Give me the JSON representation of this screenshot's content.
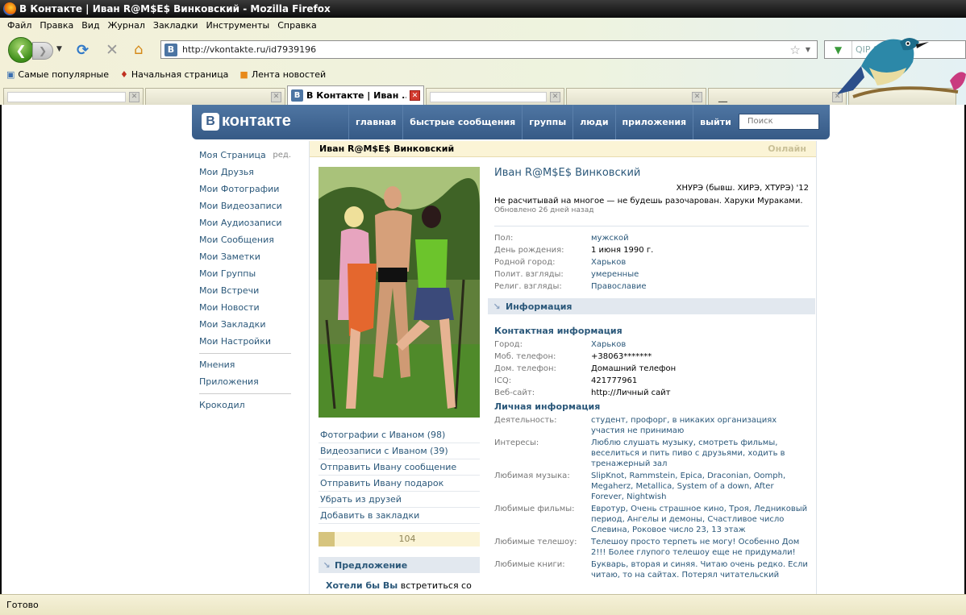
{
  "window": {
    "title": "В Контакте | Иван R@M$E$ Винковский - Mozilla Firefox"
  },
  "menu": [
    "Файл",
    "Правка",
    "Вид",
    "Журнал",
    "Закладки",
    "Инструменты",
    "Справка"
  ],
  "address_bar": {
    "url": "http://vkontakte.ru/id7939196"
  },
  "search_bar": {
    "placeholder": "QIP Search"
  },
  "bookmarks": [
    "Самые популярные",
    "Начальная страница",
    "Лента новостей"
  ],
  "tabs": {
    "active_label": "В Контакте | Иван ...",
    "last_label": "__"
  },
  "vk": {
    "logo": "контакте",
    "logo_letter": "В",
    "nav": [
      "главная",
      "быстрые сообщения",
      "группы",
      "люди",
      "приложения",
      "выйти"
    ],
    "search_placeholder": "Поиск"
  },
  "left_menu": {
    "primary": [
      "Моя Страница",
      "Мои Друзья",
      "Мои Фотографии",
      "Мои Видеозаписи",
      "Мои Аудиозаписи",
      "Мои Сообщения",
      "Мои Заметки",
      "Мои Группы",
      "Мои Встречи",
      "Мои Новости",
      "Мои Закладки",
      "Мои Настройки"
    ],
    "edit_label": "ред.",
    "secondary": [
      "Мнения",
      "Приложения"
    ],
    "tertiary": [
      "Крокодил"
    ]
  },
  "profile": {
    "header_name": "Иван R@M$E$ Винковский",
    "online": "Онлайн",
    "name": "Иван R@M$E$ Винковский",
    "education": "ХНУРЭ (бывш. ХИРЭ, ХТУРЭ) '12",
    "status": "Не расчитывай на многое — не будешь разочарован. Харуки Мураками.",
    "updated": "Обновлено 26 дней назад",
    "basic": [
      {
        "k": "Пол:",
        "v": "мужской"
      },
      {
        "k": "День рождения:",
        "v": "1 июня 1990 г."
      },
      {
        "k": "Родной город:",
        "v": "Харьков"
      },
      {
        "k": "Полит. взгляды:",
        "v": "умеренные"
      },
      {
        "k": "Религ. взгляды:",
        "v": "Православие"
      }
    ],
    "info_title": "Информация",
    "contact_title": "Контактная информация",
    "contact": [
      {
        "k": "Город:",
        "v": "Харьков"
      },
      {
        "k": "Моб. телефон:",
        "v": "+38063*******"
      },
      {
        "k": "Дом. телефон:",
        "v": "Домашний телефон"
      },
      {
        "k": "ICQ:",
        "v": "421777961"
      },
      {
        "k": "Веб-сайт:",
        "v": "http://Личный сайт"
      }
    ],
    "personal_title": "Личная информация",
    "personal": [
      {
        "k": "Деятельность:",
        "v": "студент, профорг, в никаких организациях участия не принимаю"
      },
      {
        "k": "Интересы:",
        "v": "Люблю слушать музыку, смотреть фильмы, веселиться и пить пиво с друзьями, ходить в тренажерный зал"
      },
      {
        "k": "Любимая музыка:",
        "v": "SlipKnot, Rammstein, Epica, Draconian, Oomph, Megaherz, Metallica, System of a down, After Forever, Nightwish"
      },
      {
        "k": "Любимые фильмы:",
        "v": "Евротур, Очень страшное кино, Троя, Ледниковый период, Ангелы и демоны, Счастливое число Слевина, Роковое число 23, 13 этаж"
      },
      {
        "k": "Любимые телешоу:",
        "v": "Телешоу просто терпеть не могу! Особенно Дом 2!!! Более глупого телешоу еще не придумали!"
      },
      {
        "k": "Любимые книги:",
        "v": "Букварь, вторая и синяя. Читаю очень редко. Если читаю, то на сайтах. Потерял читательский"
      }
    ],
    "actions": [
      "Фотографии с Иваном (98)",
      "Видеозаписи с Иваном (39)",
      "Отправить Ивану сообщение",
      "Отправить Ивану подарок",
      "Убрать из друзей",
      "Добавить в закладки"
    ],
    "rating": "104",
    "rating_fraction": 0.1,
    "offer_title": "Предложение",
    "offer_bold": "Хотели бы Вы",
    "offer_text": " встретиться со"
  },
  "status_bar": {
    "text": "Готово"
  }
}
